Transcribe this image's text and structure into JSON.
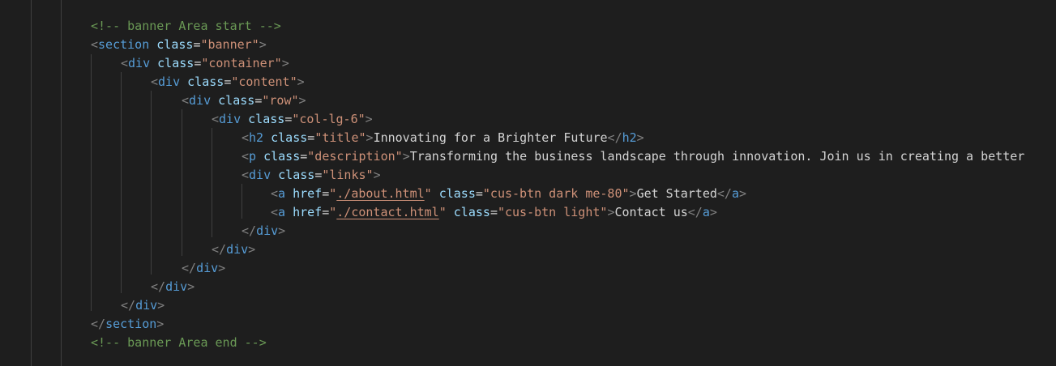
{
  "editor": {
    "theme": {
      "background": "#1e1e1e",
      "comment": "#6a9955",
      "tag": "#569cd6",
      "attribute": "#9cdcfe",
      "string": "#ce9178",
      "bracket": "#808080",
      "text": "#d4d4d4",
      "guide": "#404040"
    },
    "lines": [
      [
        {
          "t": "comment",
          "v": "<!-- banner Area start -->"
        }
      ],
      [
        {
          "t": "punct",
          "v": "<"
        },
        {
          "t": "tag",
          "v": "section"
        },
        {
          "t": "text",
          "v": " "
        },
        {
          "t": "attr",
          "v": "class"
        },
        {
          "t": "eq",
          "v": "="
        },
        {
          "t": "str",
          "v": "\"banner\""
        },
        {
          "t": "punct",
          "v": ">"
        }
      ],
      [
        {
          "t": "punct",
          "v": "<"
        },
        {
          "t": "tag",
          "v": "div"
        },
        {
          "t": "text",
          "v": " "
        },
        {
          "t": "attr",
          "v": "class"
        },
        {
          "t": "eq",
          "v": "="
        },
        {
          "t": "str",
          "v": "\"container\""
        },
        {
          "t": "punct",
          "v": ">"
        }
      ],
      [
        {
          "t": "punct",
          "v": "<"
        },
        {
          "t": "tag",
          "v": "div"
        },
        {
          "t": "text",
          "v": " "
        },
        {
          "t": "attr",
          "v": "class"
        },
        {
          "t": "eq",
          "v": "="
        },
        {
          "t": "str",
          "v": "\"content\""
        },
        {
          "t": "punct",
          "v": ">"
        }
      ],
      [
        {
          "t": "punct",
          "v": "<"
        },
        {
          "t": "tag",
          "v": "div"
        },
        {
          "t": "text",
          "v": " "
        },
        {
          "t": "attr",
          "v": "class"
        },
        {
          "t": "eq",
          "v": "="
        },
        {
          "t": "str",
          "v": "\"row\""
        },
        {
          "t": "punct",
          "v": ">"
        }
      ],
      [
        {
          "t": "punct",
          "v": "<"
        },
        {
          "t": "tag",
          "v": "div"
        },
        {
          "t": "text",
          "v": " "
        },
        {
          "t": "attr",
          "v": "class"
        },
        {
          "t": "eq",
          "v": "="
        },
        {
          "t": "str",
          "v": "\"col-lg-6\""
        },
        {
          "t": "punct",
          "v": ">"
        }
      ],
      [
        {
          "t": "punct",
          "v": "<"
        },
        {
          "t": "tag",
          "v": "h2"
        },
        {
          "t": "text",
          "v": " "
        },
        {
          "t": "attr",
          "v": "class"
        },
        {
          "t": "eq",
          "v": "="
        },
        {
          "t": "str",
          "v": "\"title\""
        },
        {
          "t": "punct",
          "v": ">"
        },
        {
          "t": "text",
          "v": "Innovating for a Brighter Future"
        },
        {
          "t": "punct",
          "v": "</"
        },
        {
          "t": "tag",
          "v": "h2"
        },
        {
          "t": "punct",
          "v": ">"
        }
      ],
      [
        {
          "t": "punct",
          "v": "<"
        },
        {
          "t": "tag",
          "v": "p"
        },
        {
          "t": "text",
          "v": " "
        },
        {
          "t": "attr",
          "v": "class"
        },
        {
          "t": "eq",
          "v": "="
        },
        {
          "t": "str",
          "v": "\"description\""
        },
        {
          "t": "punct",
          "v": ">"
        },
        {
          "t": "text",
          "v": "Transforming the business landscape through innovation. Join us in creating a better"
        }
      ],
      [
        {
          "t": "punct",
          "v": "<"
        },
        {
          "t": "tag",
          "v": "div"
        },
        {
          "t": "text",
          "v": " "
        },
        {
          "t": "attr",
          "v": "class"
        },
        {
          "t": "eq",
          "v": "="
        },
        {
          "t": "str",
          "v": "\"links\""
        },
        {
          "t": "punct",
          "v": ">"
        }
      ],
      [
        {
          "t": "punct",
          "v": "<"
        },
        {
          "t": "tag",
          "v": "a"
        },
        {
          "t": "text",
          "v": " "
        },
        {
          "t": "attr",
          "v": "href"
        },
        {
          "t": "eq",
          "v": "="
        },
        {
          "t": "str",
          "v": "\""
        },
        {
          "t": "link",
          "v": "./about.html"
        },
        {
          "t": "str",
          "v": "\""
        },
        {
          "t": "text",
          "v": " "
        },
        {
          "t": "attr",
          "v": "class"
        },
        {
          "t": "eq",
          "v": "="
        },
        {
          "t": "str",
          "v": "\"cus-btn dark me-80\""
        },
        {
          "t": "punct",
          "v": ">"
        },
        {
          "t": "text",
          "v": "Get Started"
        },
        {
          "t": "punct",
          "v": "</"
        },
        {
          "t": "tag",
          "v": "a"
        },
        {
          "t": "punct",
          "v": ">"
        }
      ],
      [
        {
          "t": "punct",
          "v": "<"
        },
        {
          "t": "tag",
          "v": "a"
        },
        {
          "t": "text",
          "v": " "
        },
        {
          "t": "attr",
          "v": "href"
        },
        {
          "t": "eq",
          "v": "="
        },
        {
          "t": "str",
          "v": "\""
        },
        {
          "t": "link",
          "v": "./contact.html"
        },
        {
          "t": "str",
          "v": "\""
        },
        {
          "t": "text",
          "v": " "
        },
        {
          "t": "attr",
          "v": "class"
        },
        {
          "t": "eq",
          "v": "="
        },
        {
          "t": "str",
          "v": "\"cus-btn light\""
        },
        {
          "t": "punct",
          "v": ">"
        },
        {
          "t": "text",
          "v": "Contact us"
        },
        {
          "t": "punct",
          "v": "</"
        },
        {
          "t": "tag",
          "v": "a"
        },
        {
          "t": "punct",
          "v": ">"
        }
      ],
      [
        {
          "t": "punct",
          "v": "</"
        },
        {
          "t": "tag",
          "v": "div"
        },
        {
          "t": "punct",
          "v": ">"
        }
      ],
      [
        {
          "t": "punct",
          "v": "</"
        },
        {
          "t": "tag",
          "v": "div"
        },
        {
          "t": "punct",
          "v": ">"
        }
      ],
      [
        {
          "t": "punct",
          "v": "</"
        },
        {
          "t": "tag",
          "v": "div"
        },
        {
          "t": "punct",
          "v": ">"
        }
      ],
      [
        {
          "t": "punct",
          "v": "</"
        },
        {
          "t": "tag",
          "v": "div"
        },
        {
          "t": "punct",
          "v": ">"
        }
      ],
      [
        {
          "t": "punct",
          "v": "</"
        },
        {
          "t": "tag",
          "v": "div"
        },
        {
          "t": "punct",
          "v": ">"
        }
      ],
      [
        {
          "t": "punct",
          "v": "</"
        },
        {
          "t": "tag",
          "v": "section"
        },
        {
          "t": "punct",
          "v": ">"
        }
      ],
      [
        {
          "t": "comment",
          "v": "<!-- banner Area end -->"
        }
      ]
    ]
  }
}
